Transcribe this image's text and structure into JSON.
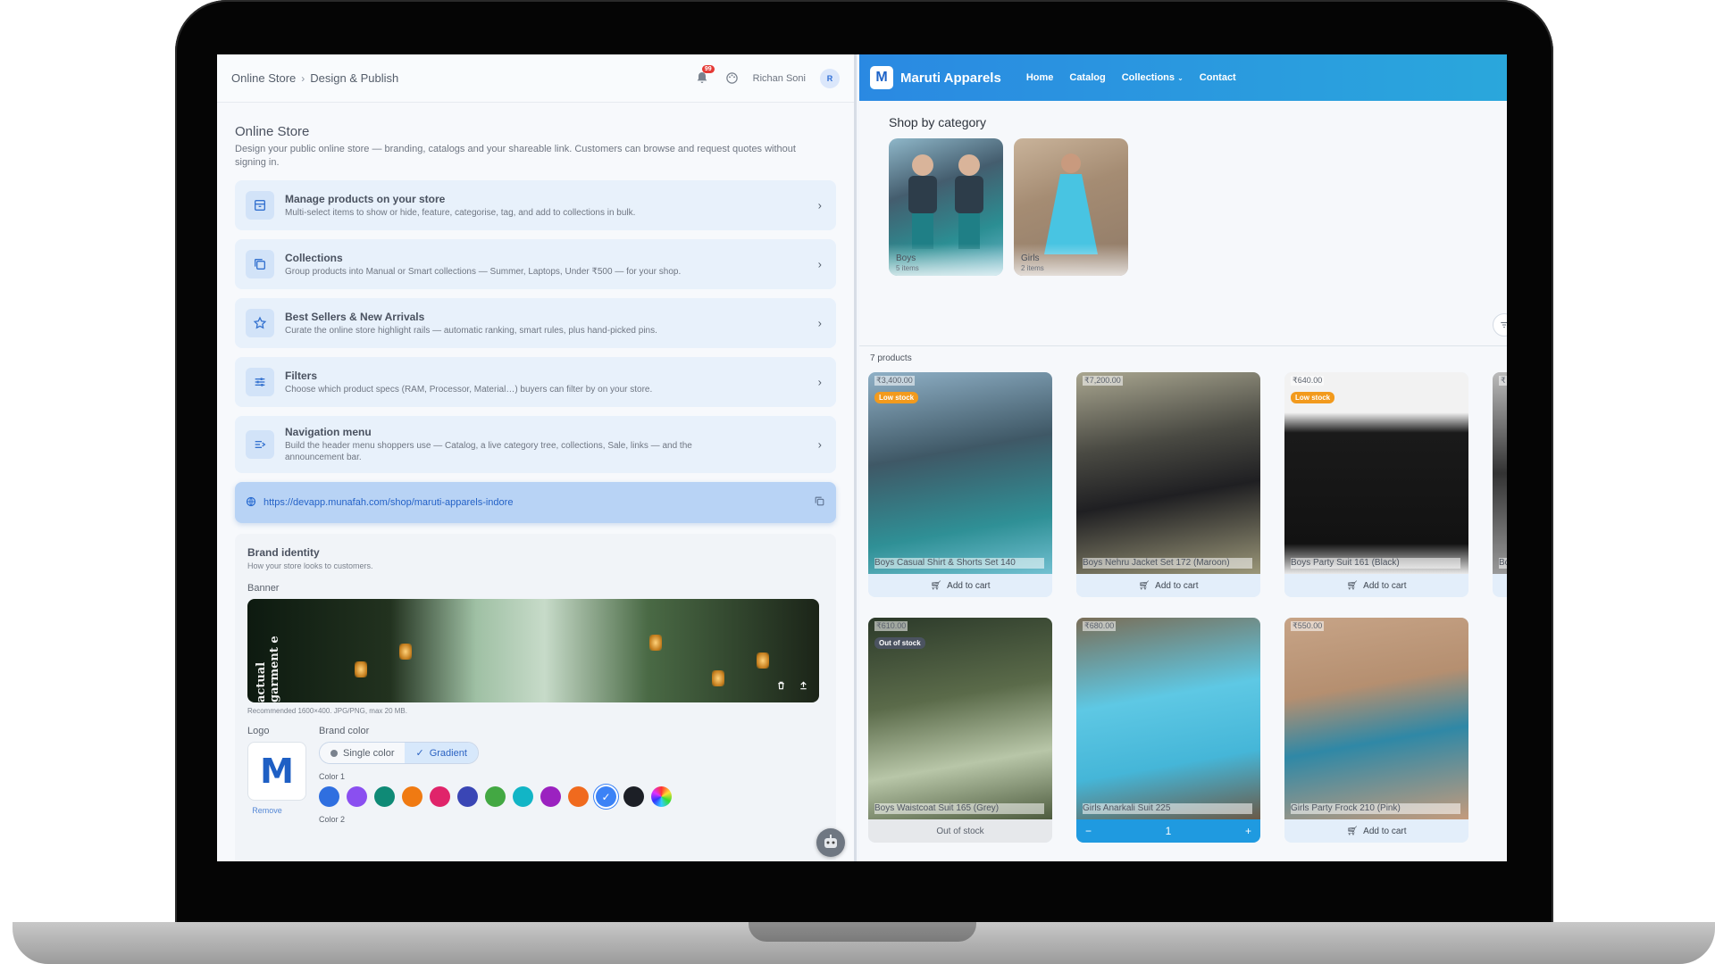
{
  "admin": {
    "breadcrumb": [
      "Online Store",
      "Design & Publish"
    ],
    "notif_count": "99",
    "user_name": "Richan Soni",
    "user_initial": "R",
    "page_title": "Online Store",
    "page_desc": "Design your public online store — branding, catalogs and your shareable link. Customers can browse and request quotes without signing in.",
    "menu": [
      {
        "title": "Manage products on your store",
        "sub": "Multi-select items to show or hide, feature, categorise, tag, and add to collections in bulk.",
        "icon": "store-icon"
      },
      {
        "title": "Collections",
        "sub": "Group products into Manual or Smart collections — Summer, Laptops, Under ₹500 — for your shop.",
        "icon": "collections-icon"
      },
      {
        "title": "Best Sellers & New Arrivals",
        "sub": "Curate the online store highlight rails — automatic ranking, smart rules, plus hand-picked pins.",
        "icon": "star-icon"
      },
      {
        "title": "Filters",
        "sub": "Choose which product specs (RAM, Processor, Material…) buyers can filter by on your store.",
        "icon": "sliders-icon"
      },
      {
        "title": "Navigation menu",
        "sub": "Build the header menu shoppers use — Catalog, a live category tree, collections, Sale, links — and the announcement bar.",
        "icon": "menu-icon"
      }
    ],
    "store_url": "https://devapp.munafah.com/shop/maruti-apparels-indore",
    "brand": {
      "title": "Brand identity",
      "sub": "How your store looks to customers.",
      "banner_label": "Banner",
      "banner_text": "actual garment e",
      "banner_hint": "Recommended 1600×400. JPG/PNG, max 20 MB.",
      "logo_label": "Logo",
      "logo_remove": "Remove",
      "color_label": "Brand color",
      "toggle_single": "Single color",
      "toggle_gradient": "Gradient",
      "color1_label": "Color 1",
      "color2_label": "Color 2",
      "swatches": [
        "#2f6fe0",
        "#8a4ff0",
        "#0f8a76",
        "#f07a12",
        "#e0246a",
        "#3a46b5",
        "#43a843",
        "#12b5c6",
        "#9b22c0",
        "#f06a1e",
        "#3b82f6",
        "#1c1f26",
        "#rainbow"
      ]
    }
  },
  "store": {
    "brand_initial": "M",
    "name": "Maruti Apparels",
    "nav": [
      "Home",
      "Catalog",
      "Collections",
      "Contact"
    ],
    "category_title": "Shop by category",
    "categories": [
      {
        "name": "Boys",
        "count": "5 items"
      },
      {
        "name": "Girls",
        "count": "2 items"
      }
    ],
    "product_count": "7 products",
    "products": [
      {
        "price": "₹3,400.00",
        "badge": "Low stock",
        "name": "Boys Casual Shirt & Shorts Set 140",
        "action": "Add to cart"
      },
      {
        "price": "₹7,200.00",
        "badge": "",
        "name": "Boys Nehru Jacket Set 172 (Maroon)",
        "action": "Add to cart"
      },
      {
        "price": "₹640.00",
        "badge": "Low stock",
        "name": "Boys Party Suit 161 (Black)",
        "action": "Add to cart"
      },
      {
        "price": "₹610.00",
        "badge": "Out of stock",
        "name": "Boys Waistcoat Suit 165 (Grey)",
        "action": "Out of stock"
      },
      {
        "price": "₹680.00",
        "badge": "",
        "name": "Girls Anarkali Suit 225",
        "action": "stepper",
        "qty": "1"
      },
      {
        "price": "₹550.00",
        "badge": "",
        "name": "Girls Party Frock 210 (Pink)",
        "action": "Add to cart"
      }
    ],
    "partial_price": "₹",
    "partial_name": "Bo"
  }
}
